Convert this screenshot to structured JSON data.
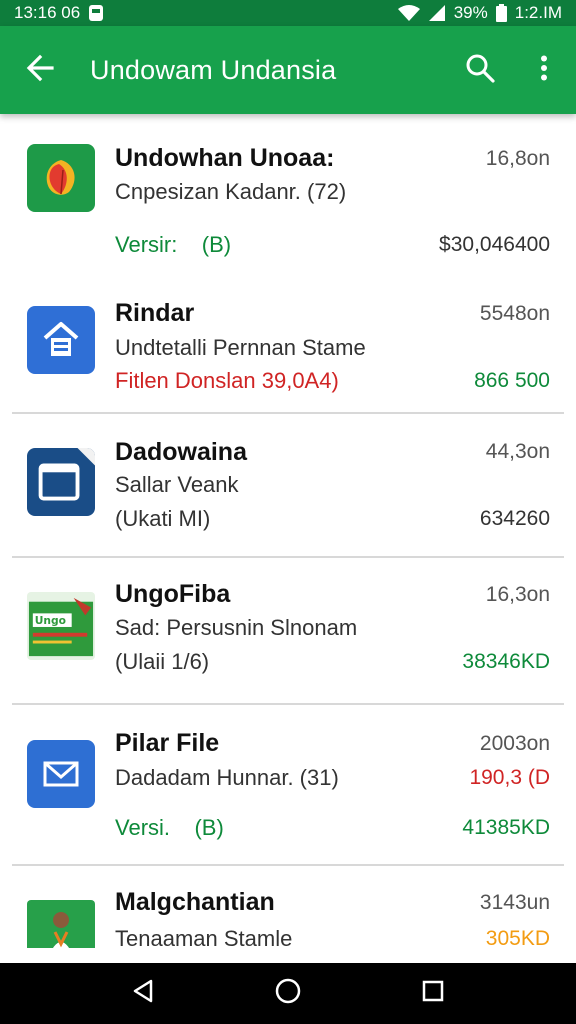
{
  "status_bar": {
    "time_left": "13:16 06",
    "battery_percent": "39%",
    "time_right": "1:2.IM"
  },
  "app_bar": {
    "title": "Undowam Undansia",
    "icons": [
      "back-arrow-icon",
      "search-icon",
      "more-vert-icon"
    ]
  },
  "apps": [
    {
      "title": "Undowhan Unoaa:",
      "size": "16,8on",
      "line2": "Cnpesizan Kadanr. (72)",
      "line3_left": "Versir:    (B)",
      "line3_right": "$30,046400",
      "line3_left_color": "#0e8a3a",
      "line3_right_color": "#333333",
      "icon": "leaf-app-icon"
    },
    {
      "title": "Rindar",
      "size": "5548on",
      "line2": "Undtetalli Pernnan Stame",
      "line3_left": "Fitlen Donslan 39,0A4)",
      "line3_right": "866 500",
      "line3_left_color": "#d02424",
      "line3_right_color": "#0e8a3a",
      "icon": "house-app-icon"
    },
    {
      "title": "Dadowaina",
      "size": "44,3on",
      "line2": "Sallar Veank",
      "line3_left": "(Ukati MI)",
      "line3_right": "634260",
      "line3_left_color": "#333333",
      "line3_right_color": "#333333",
      "icon": "window-app-icon"
    },
    {
      "title": "UngoFiba",
      "size": "16,3on",
      "line2": "Sad: Persusnin Slnonam",
      "line3_left": "(Ulaii 1/6)",
      "line3_right": "38346KD",
      "line3_left_color": "#333333",
      "line3_right_color": "#0e8a3a",
      "icon": "banner-app-icon"
    },
    {
      "title": "Pilar File",
      "size": "2003on",
      "line2": "Dadadam Hunnar. (31)",
      "line3_left": "Versi.    (B)",
      "line3_right": "41385KD",
      "line2_right": "190,3 (D",
      "line3_left_color": "#0e8a3a",
      "line3_right_color": "#0e8a3a",
      "icon": "mail-app-icon"
    },
    {
      "title": "Malgchantian",
      "size": "3143un",
      "line2": "Tenaaman Stamle",
      "line2_right": "305KD",
      "icon": "person-app-icon"
    }
  ],
  "nav": {
    "icons": [
      "back-triangle-icon",
      "home-circle-icon",
      "recents-square-icon"
    ]
  }
}
